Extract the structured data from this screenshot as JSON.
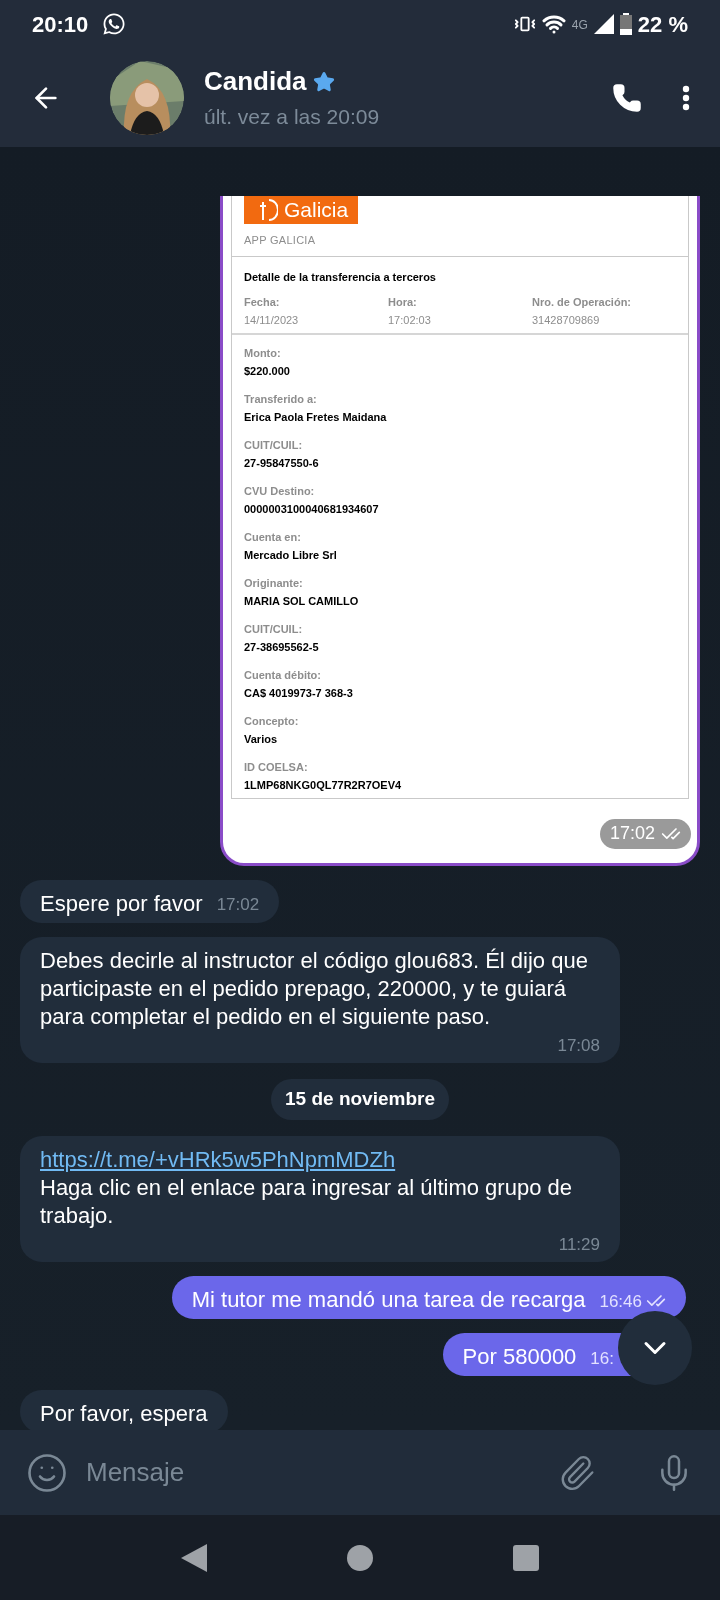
{
  "status_bar": {
    "time": "20:10",
    "network": "4G",
    "battery": "22 %"
  },
  "header": {
    "name": "Candida",
    "starred": true,
    "status": "últ. vez a las 20:09"
  },
  "messages": [
    {
      "kind": "receipt",
      "outgoing": true,
      "time": "17:02",
      "read": true,
      "receipt": {
        "brand": "Galicia",
        "app": "APP GALICIA",
        "title": "Detalle de la transferencia a terceros",
        "summary": [
          {
            "label": "Fecha:",
            "value": "14/11/2023"
          },
          {
            "label": "Hora:",
            "value": "17:02:03"
          },
          {
            "label": "Nro. de Operación:",
            "value": "31428709869"
          }
        ],
        "fields": [
          {
            "label": "Monto:",
            "value": "$220.000"
          },
          {
            "label": "Transferido a:",
            "value": "Erica Paola Fretes Maidana"
          },
          {
            "label": "CUIT/CUIL:",
            "value": "27-95847550-6"
          },
          {
            "label": "CVU Destino:",
            "value": "0000003100040681934607"
          },
          {
            "label": "Cuenta en:",
            "value": "Mercado Libre Srl"
          },
          {
            "label": "Originante:",
            "value": "MARIA SOL CAMILLO"
          },
          {
            "label": "CUIT/CUIL:",
            "value": "27-38695562-5"
          },
          {
            "label": "Cuenta débito:",
            "value": "CA$ 4019973-7 368-3"
          },
          {
            "label": "Concepto:",
            "value": "Varios"
          },
          {
            "label": "ID COELSA:",
            "value": "1LMP68NKG0QL77R2R7OEV4"
          }
        ]
      }
    },
    {
      "kind": "text",
      "outgoing": false,
      "text": "Espere por favor",
      "time": "17:02"
    },
    {
      "kind": "text",
      "outgoing": false,
      "text": "Debes decirle al instructor el código glou683. Él dijo que participaste en el pedido prepago, 220000, y te guiará para completar el pedido en el siguiente paso.",
      "time": "17:08"
    },
    {
      "kind": "date",
      "text": "15 de noviembre"
    },
    {
      "kind": "text",
      "outgoing": false,
      "link": "https://t.me/+vHRk5w5PhNpmMDZh",
      "text": "Haga clic en el enlace para ingresar al último grupo de trabajo.",
      "time": "11:29"
    },
    {
      "kind": "text",
      "outgoing": true,
      "text": "Mi tutor me mandó una tarea de recarga",
      "time": "16:46",
      "read": true
    },
    {
      "kind": "text",
      "outgoing": true,
      "text": "Por 580000",
      "time": "16:"
    },
    {
      "kind": "partial",
      "outgoing": false,
      "text": "Por favor, espera"
    }
  ],
  "composer": {
    "placeholder": "Mensaje"
  }
}
